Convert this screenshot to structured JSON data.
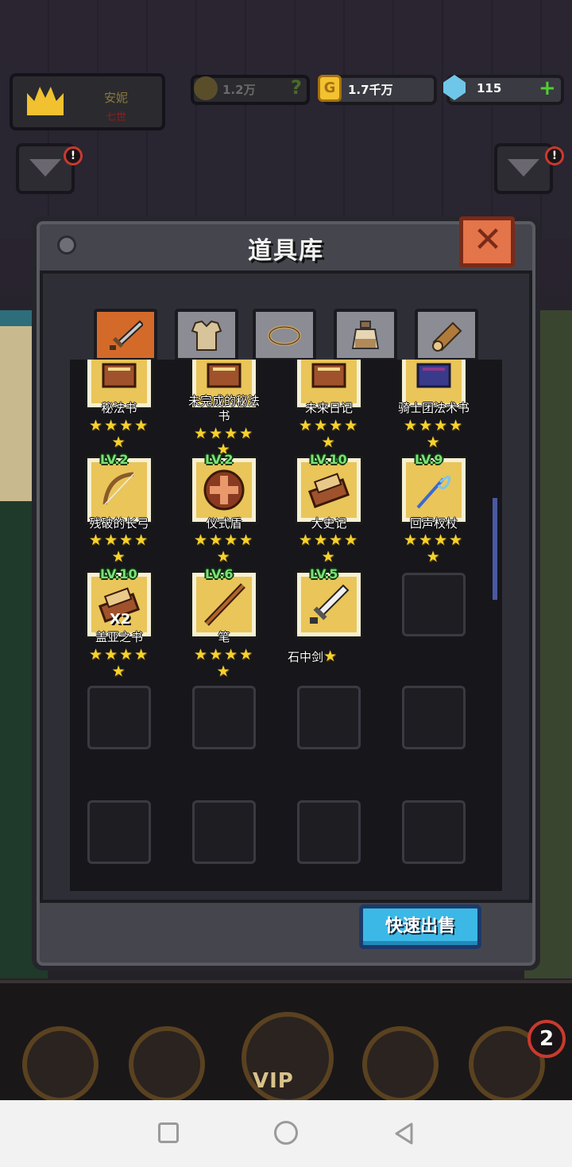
{
  "hud": {
    "player_name": "安妮",
    "player_sub": "七世",
    "power": "1.2万",
    "power_help": "?",
    "gold": "1.7千万",
    "gold_icon_glyph": "G",
    "gems": "115",
    "gems_plus": "+",
    "alert_glyph": "!"
  },
  "panel": {
    "title": "道具库",
    "close_glyph": "✕",
    "tabs": [
      {
        "name": "weapon",
        "icon": "sword-icon",
        "active": true
      },
      {
        "name": "armor",
        "icon": "armor-icon",
        "active": false
      },
      {
        "name": "ring",
        "icon": "ring-icon",
        "active": false
      },
      {
        "name": "potion",
        "icon": "potion-icon",
        "active": false
      },
      {
        "name": "material",
        "icon": "log-icon",
        "active": false
      }
    ],
    "items": [
      {
        "name": "秘法书",
        "level": "",
        "count": "",
        "stars": "★★★★",
        "stars2": "★",
        "icon": "spellbook-icon"
      },
      {
        "name": "未完成的秘法",
        "name2": "书",
        "level": "",
        "count": "",
        "stars": "★★★★",
        "stars2": "★",
        "icon": "spellbook-icon"
      },
      {
        "name": "未来日记",
        "level": "",
        "count": "",
        "stars": "★★★★",
        "stars2": "★",
        "icon": "diary-icon"
      },
      {
        "name": "骑士团法术书",
        "level": "",
        "count": "",
        "stars": "★★★★",
        "stars2": "★",
        "icon": "spellbook-blue-icon"
      },
      {
        "name": "残破的长弓",
        "level": "LV.2",
        "count": "",
        "stars": "★★★★",
        "stars2": "★",
        "icon": "bow-icon"
      },
      {
        "name": "仪式盾",
        "level": "LV.2",
        "count": "",
        "stars": "★★★★",
        "stars2": "★",
        "icon": "shield-icon"
      },
      {
        "name": "大史记",
        "level": "LV.10",
        "count": "",
        "stars": "★★★★",
        "stars2": "★",
        "icon": "scroll-book-icon"
      },
      {
        "name": "回声权杖",
        "level": "LV.9",
        "count": "",
        "stars": "★★★★",
        "stars2": "★",
        "icon": "staff-icon"
      },
      {
        "name": "盖亚之书",
        "level": "LV.10",
        "count": "X2",
        "stars": "★★★★",
        "stars2": "★",
        "icon": "scroll-book-icon"
      },
      {
        "name": "笔",
        "level": "LV.6",
        "count": "",
        "stars": "★★★★",
        "stars2": "★",
        "icon": "pen-icon"
      },
      {
        "name": "石中剑",
        "level": "LV.5",
        "count": "",
        "stars": "★",
        "stars2": "",
        "icon": "sword-in-stone-icon"
      }
    ],
    "quick_sell": "快速出售"
  },
  "bottom_nav": {
    "vip": "VIP",
    "badge": "2"
  },
  "colors": {
    "gold_frame": "#e9c55a",
    "level_green": "#7ce07a",
    "star_yellow": "#f6d22e",
    "close_orange": "#e4744a",
    "sell_blue": "#3cb8e6"
  }
}
